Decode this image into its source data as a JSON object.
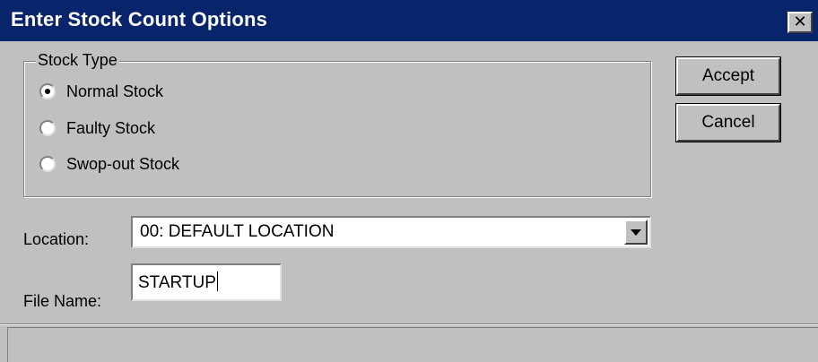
{
  "window": {
    "title": "Enter Stock Count Options",
    "close_glyph": "✕",
    "title_bar_color": "#08246b",
    "face_color": "#c0c0c0"
  },
  "stock_type": {
    "legend": "Stock Type",
    "selected": "Normal Stock",
    "options": [
      {
        "label": "Normal Stock",
        "checked": true
      },
      {
        "label": "Faulty Stock",
        "checked": false
      },
      {
        "label": "Swop-out Stock",
        "checked": false
      }
    ]
  },
  "buttons": {
    "accept_label": "Accept",
    "cancel_label": "Cancel"
  },
  "location": {
    "label": "Location:",
    "value": "00: DEFAULT LOCATION",
    "dropdown_icon": "chevron-down-icon"
  },
  "file_name": {
    "label": "File Name:",
    "value": "STARTUP"
  }
}
